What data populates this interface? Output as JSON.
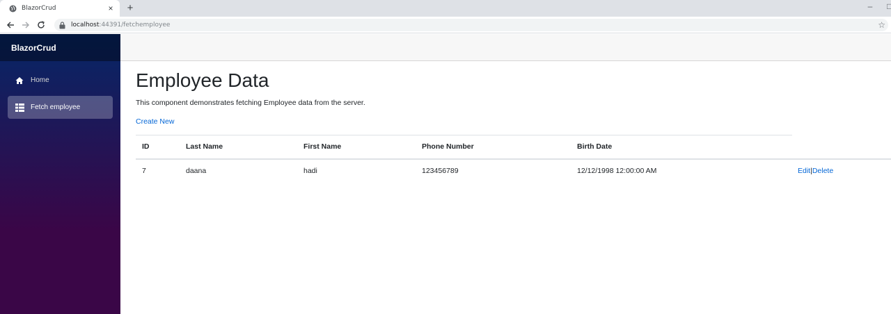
{
  "browser": {
    "tab_title": "BlazorCrud",
    "url_host": "localhost",
    "url_path": ":44391/fetchemployee"
  },
  "sidebar": {
    "brand": "BlazorCrud",
    "items": [
      {
        "label": "Home",
        "icon": "home-icon",
        "active": false
      },
      {
        "label": "Fetch employee",
        "icon": "list-icon",
        "active": true
      }
    ]
  },
  "main": {
    "title": "Employee Data",
    "description": "This component demonstrates fetching Employee data from the server.",
    "create_link": "Create New",
    "table": {
      "headers": [
        "ID",
        "Last Name",
        "First Name",
        "Phone Number",
        "Birth Date"
      ],
      "rows": [
        {
          "id": "7",
          "last_name": "daana",
          "first_name": "hadi",
          "phone": "123456789",
          "birth_date": "12/12/1998 12:00:00 AM",
          "edit": "Edit",
          "separator": "|",
          "delete": "Delete"
        }
      ]
    }
  },
  "colors": {
    "link": "#0366d6",
    "sidebar_top": "#052767",
    "sidebar_bottom": "#3a0647"
  }
}
